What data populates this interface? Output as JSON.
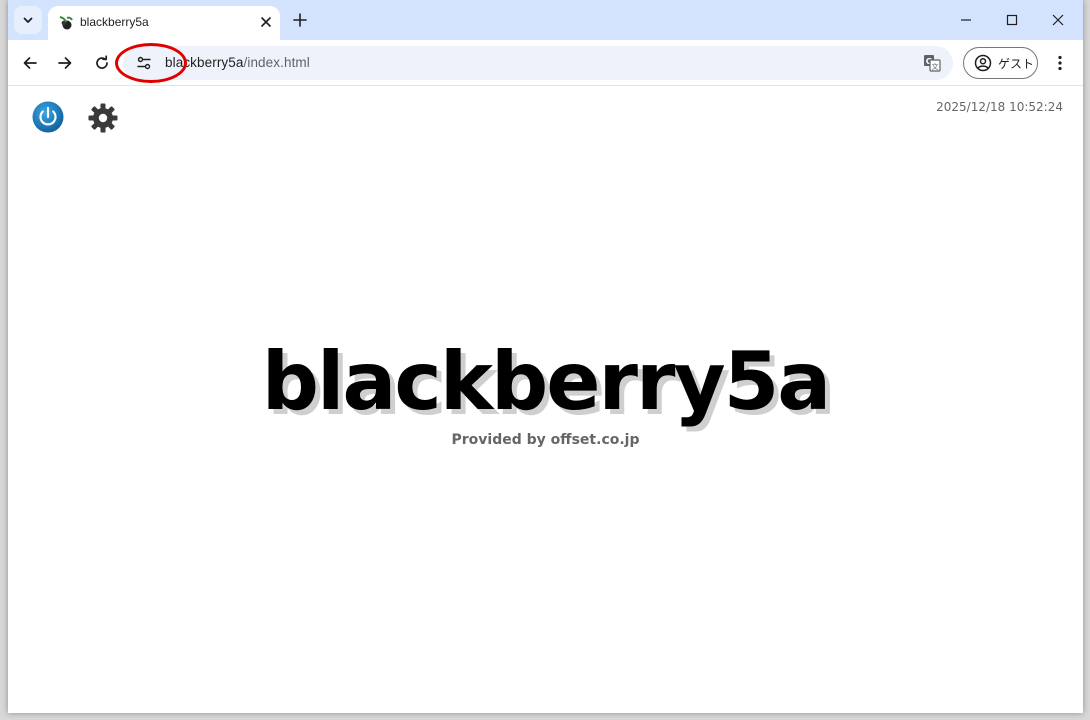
{
  "browser": {
    "tab_title": "blackberry5a",
    "url_host": "blackberry5a",
    "url_path": "/index.html",
    "profile_label": "ゲスト"
  },
  "page": {
    "datetime": "2025/12/18 10:52:24",
    "title": "blackberry5a",
    "subtitle": "Provided by offset.co.jp"
  },
  "icons": {
    "tab_search": "chevron-down-icon",
    "favicon": "blackberry-icon",
    "tab_close": "close-icon",
    "new_tab": "plus-icon",
    "back": "arrow-left-icon",
    "forward": "arrow-right-icon",
    "reload": "reload-icon",
    "site_info": "tune-icon",
    "translate": "translate-icon",
    "profile": "person-circle-icon",
    "menu": "more-vertical-icon",
    "power": "power-icon",
    "settings": "gear-icon"
  },
  "colors": {
    "tabstrip": "#d3e3fd",
    "power_button": "#1a7fc1",
    "annotation": "#e00000"
  }
}
